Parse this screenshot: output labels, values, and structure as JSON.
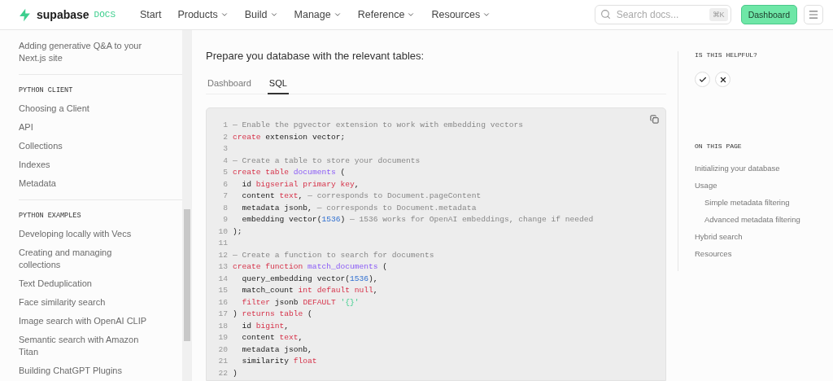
{
  "header": {
    "brand": "supabase",
    "brand_suffix": "DOCS",
    "nav": [
      {
        "label": "Start",
        "dropdown": false
      },
      {
        "label": "Products",
        "dropdown": true
      },
      {
        "label": "Build",
        "dropdown": true
      },
      {
        "label": "Manage",
        "dropdown": true
      },
      {
        "label": "Reference",
        "dropdown": true
      },
      {
        "label": "Resources",
        "dropdown": true
      }
    ],
    "search": {
      "placeholder": "Search docs...",
      "shortcut": "⌘K"
    },
    "dashboard_button": "Dashboard"
  },
  "sidebar": {
    "sections": [
      {
        "items": [
          "Adding generative Q&A to your Next.js site"
        ]
      },
      {
        "title": "PYTHON CLIENT",
        "items": [
          "Choosing a Client",
          "API",
          "Collections",
          "Indexes",
          "Metadata"
        ]
      },
      {
        "title": "PYTHON EXAMPLES",
        "items": [
          "Developing locally with Vecs",
          "Creating and managing collections",
          "Text Deduplication",
          "Face similarity search",
          "Image search with OpenAI CLIP",
          "Semantic search with Amazon Titan",
          "Building ChatGPT Plugins"
        ]
      }
    ]
  },
  "main": {
    "intro": "Prepare you database with the relevant tables:",
    "tabs": [
      {
        "label": "Dashboard",
        "selected": false
      },
      {
        "label": "SQL",
        "selected": true
      }
    ],
    "code": [
      {
        "number": "1",
        "tokens": [
          {
            "kind": "comment",
            "text": "— Enable the pgvector extension to work with embedding vectors"
          }
        ]
      },
      {
        "number": "2",
        "tokens": [
          {
            "kind": "keyword",
            "text": "create"
          },
          {
            "kind": "plain",
            "text": " extension vector;"
          }
        ]
      },
      {
        "number": "3"
      },
      {
        "number": "4",
        "tokens": [
          {
            "kind": "comment",
            "text": "— Create a table to store your documents"
          }
        ]
      },
      {
        "number": "5",
        "tokens": [
          {
            "kind": "keyword",
            "text": "create table"
          },
          {
            "kind": "name",
            "text": " documents"
          },
          {
            "kind": "plain",
            "text": " ("
          }
        ]
      },
      {
        "number": "6",
        "tokens": [
          {
            "kind": "plain",
            "text": "  id "
          },
          {
            "kind": "keyword",
            "text": "bigserial primary key"
          },
          {
            "kind": "plain",
            "text": ","
          }
        ]
      },
      {
        "number": "7",
        "tokens": [
          {
            "kind": "plain",
            "text": "  content "
          },
          {
            "kind": "keyword",
            "text": "text"
          },
          {
            "kind": "plain",
            "text": ", "
          },
          {
            "kind": "comment",
            "text": "— corresponds to Document.pageContent"
          }
        ]
      },
      {
        "number": "8",
        "tokens": [
          {
            "kind": "plain",
            "text": "  metadata jsonb, "
          },
          {
            "kind": "comment",
            "text": "— corresponds to Document.metadata"
          }
        ]
      },
      {
        "number": "9",
        "tokens": [
          {
            "kind": "plain",
            "text": "  embedding vector("
          },
          {
            "kind": "number",
            "text": "1536"
          },
          {
            "kind": "plain",
            "text": ") "
          },
          {
            "kind": "comment",
            "text": "— 1536 works for OpenAI embeddings, change if needed"
          }
        ]
      },
      {
        "number": "10",
        "tokens": [
          {
            "kind": "plain",
            "text": ");"
          }
        ]
      },
      {
        "number": "11"
      },
      {
        "number": "12",
        "tokens": [
          {
            "kind": "comment",
            "text": "— Create a function to search for documents"
          }
        ]
      },
      {
        "number": "13",
        "tokens": [
          {
            "kind": "keyword",
            "text": "create function"
          },
          {
            "kind": "name",
            "text": " match_documents"
          },
          {
            "kind": "plain",
            "text": " ("
          }
        ]
      },
      {
        "number": "14",
        "tokens": [
          {
            "kind": "plain",
            "text": "  query_embedding vector("
          },
          {
            "kind": "number",
            "text": "1536"
          },
          {
            "kind": "plain",
            "text": "),"
          }
        ]
      },
      {
        "number": "15",
        "tokens": [
          {
            "kind": "plain",
            "text": "  match_count "
          },
          {
            "kind": "keyword",
            "text": "int default null"
          },
          {
            "kind": "plain",
            "text": ","
          }
        ]
      },
      {
        "number": "16",
        "tokens": [
          {
            "kind": "keyword",
            "text": "  filter"
          },
          {
            "kind": "plain",
            "text": " jsonb "
          },
          {
            "kind": "keyword",
            "text": "DEFAULT"
          },
          {
            "kind": "string",
            "text": " '{}'"
          }
        ]
      },
      {
        "number": "17",
        "tokens": [
          {
            "kind": "plain",
            "text": ") "
          },
          {
            "kind": "keyword",
            "text": "returns table"
          },
          {
            "kind": "plain",
            "text": " ("
          }
        ]
      },
      {
        "number": "18",
        "tokens": [
          {
            "kind": "plain",
            "text": "  id "
          },
          {
            "kind": "keyword",
            "text": "bigint"
          },
          {
            "kind": "plain",
            "text": ","
          }
        ]
      },
      {
        "number": "19",
        "tokens": [
          {
            "kind": "plain",
            "text": "  content "
          },
          {
            "kind": "keyword",
            "text": "text"
          },
          {
            "kind": "plain",
            "text": ","
          }
        ]
      },
      {
        "number": "20",
        "tokens": [
          {
            "kind": "plain",
            "text": "  metadata jsonb,"
          }
        ]
      },
      {
        "number": "21",
        "tokens": [
          {
            "kind": "plain",
            "text": "  similarity "
          },
          {
            "kind": "keyword",
            "text": "float"
          }
        ]
      },
      {
        "number": "22",
        "tokens": [
          {
            "kind": "plain",
            "text": ")"
          }
        ]
      }
    ]
  },
  "aside": {
    "feedback_title": "IS THIS HELPFUL?",
    "toc_title": "ON THIS PAGE",
    "toc": [
      {
        "label": "Initializing your database"
      },
      {
        "label": "Usage",
        "children": [
          {
            "label": "Simple metadata filtering"
          },
          {
            "label": "Advanced metadata filtering"
          }
        ]
      },
      {
        "label": "Hybrid search"
      },
      {
        "label": "Resources"
      }
    ]
  }
}
